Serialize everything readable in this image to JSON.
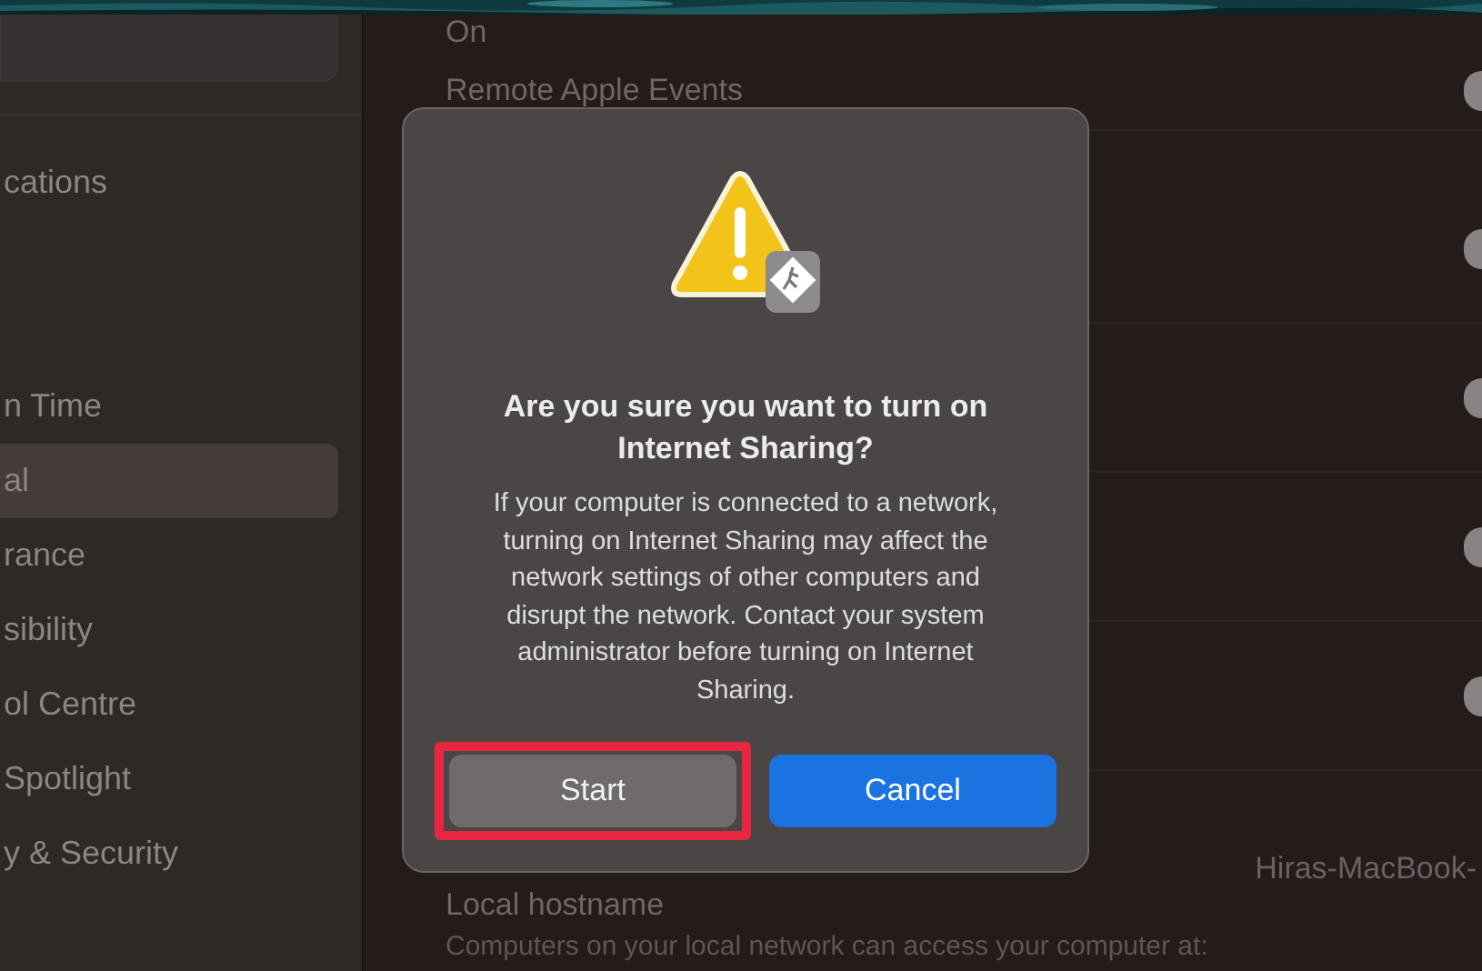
{
  "sidebar": {
    "items": [
      {
        "label": "cations",
        "selected": false
      },
      {
        "label": "n Time",
        "selected": false
      },
      {
        "label": "al",
        "selected": true
      },
      {
        "label": "rance",
        "selected": false
      },
      {
        "label": "sibility",
        "selected": false
      },
      {
        "label": "ol Centre",
        "selected": false
      },
      {
        "label": "Spotlight",
        "selected": false
      },
      {
        "label": "y & Security",
        "selected": false
      }
    ]
  },
  "settings": {
    "rows": [
      {
        "label": "On"
      },
      {
        "label": "Remote Apple Events",
        "on": false
      },
      {
        "on": false
      },
      {
        "on": false
      },
      {
        "on": false
      },
      {
        "on": false
      }
    ],
    "hostname": {
      "label": "Local hostname",
      "value": "Hiras-MacBook-"
    },
    "note": "Computers on your local network can access your computer at:"
  },
  "dialog": {
    "title": "Are you sure you want to turn on Internet Sharing?",
    "message": "If your computer is connected to a network, turning on Internet Sharing may affect the network settings of other computers and disrupt the network. Contact your system administrator before turning on Internet Sharing.",
    "buttons": [
      {
        "label": "Start",
        "kind": "secondary",
        "highlighted": true
      },
      {
        "label": "Cancel",
        "kind": "primary",
        "highlighted": false
      }
    ]
  }
}
